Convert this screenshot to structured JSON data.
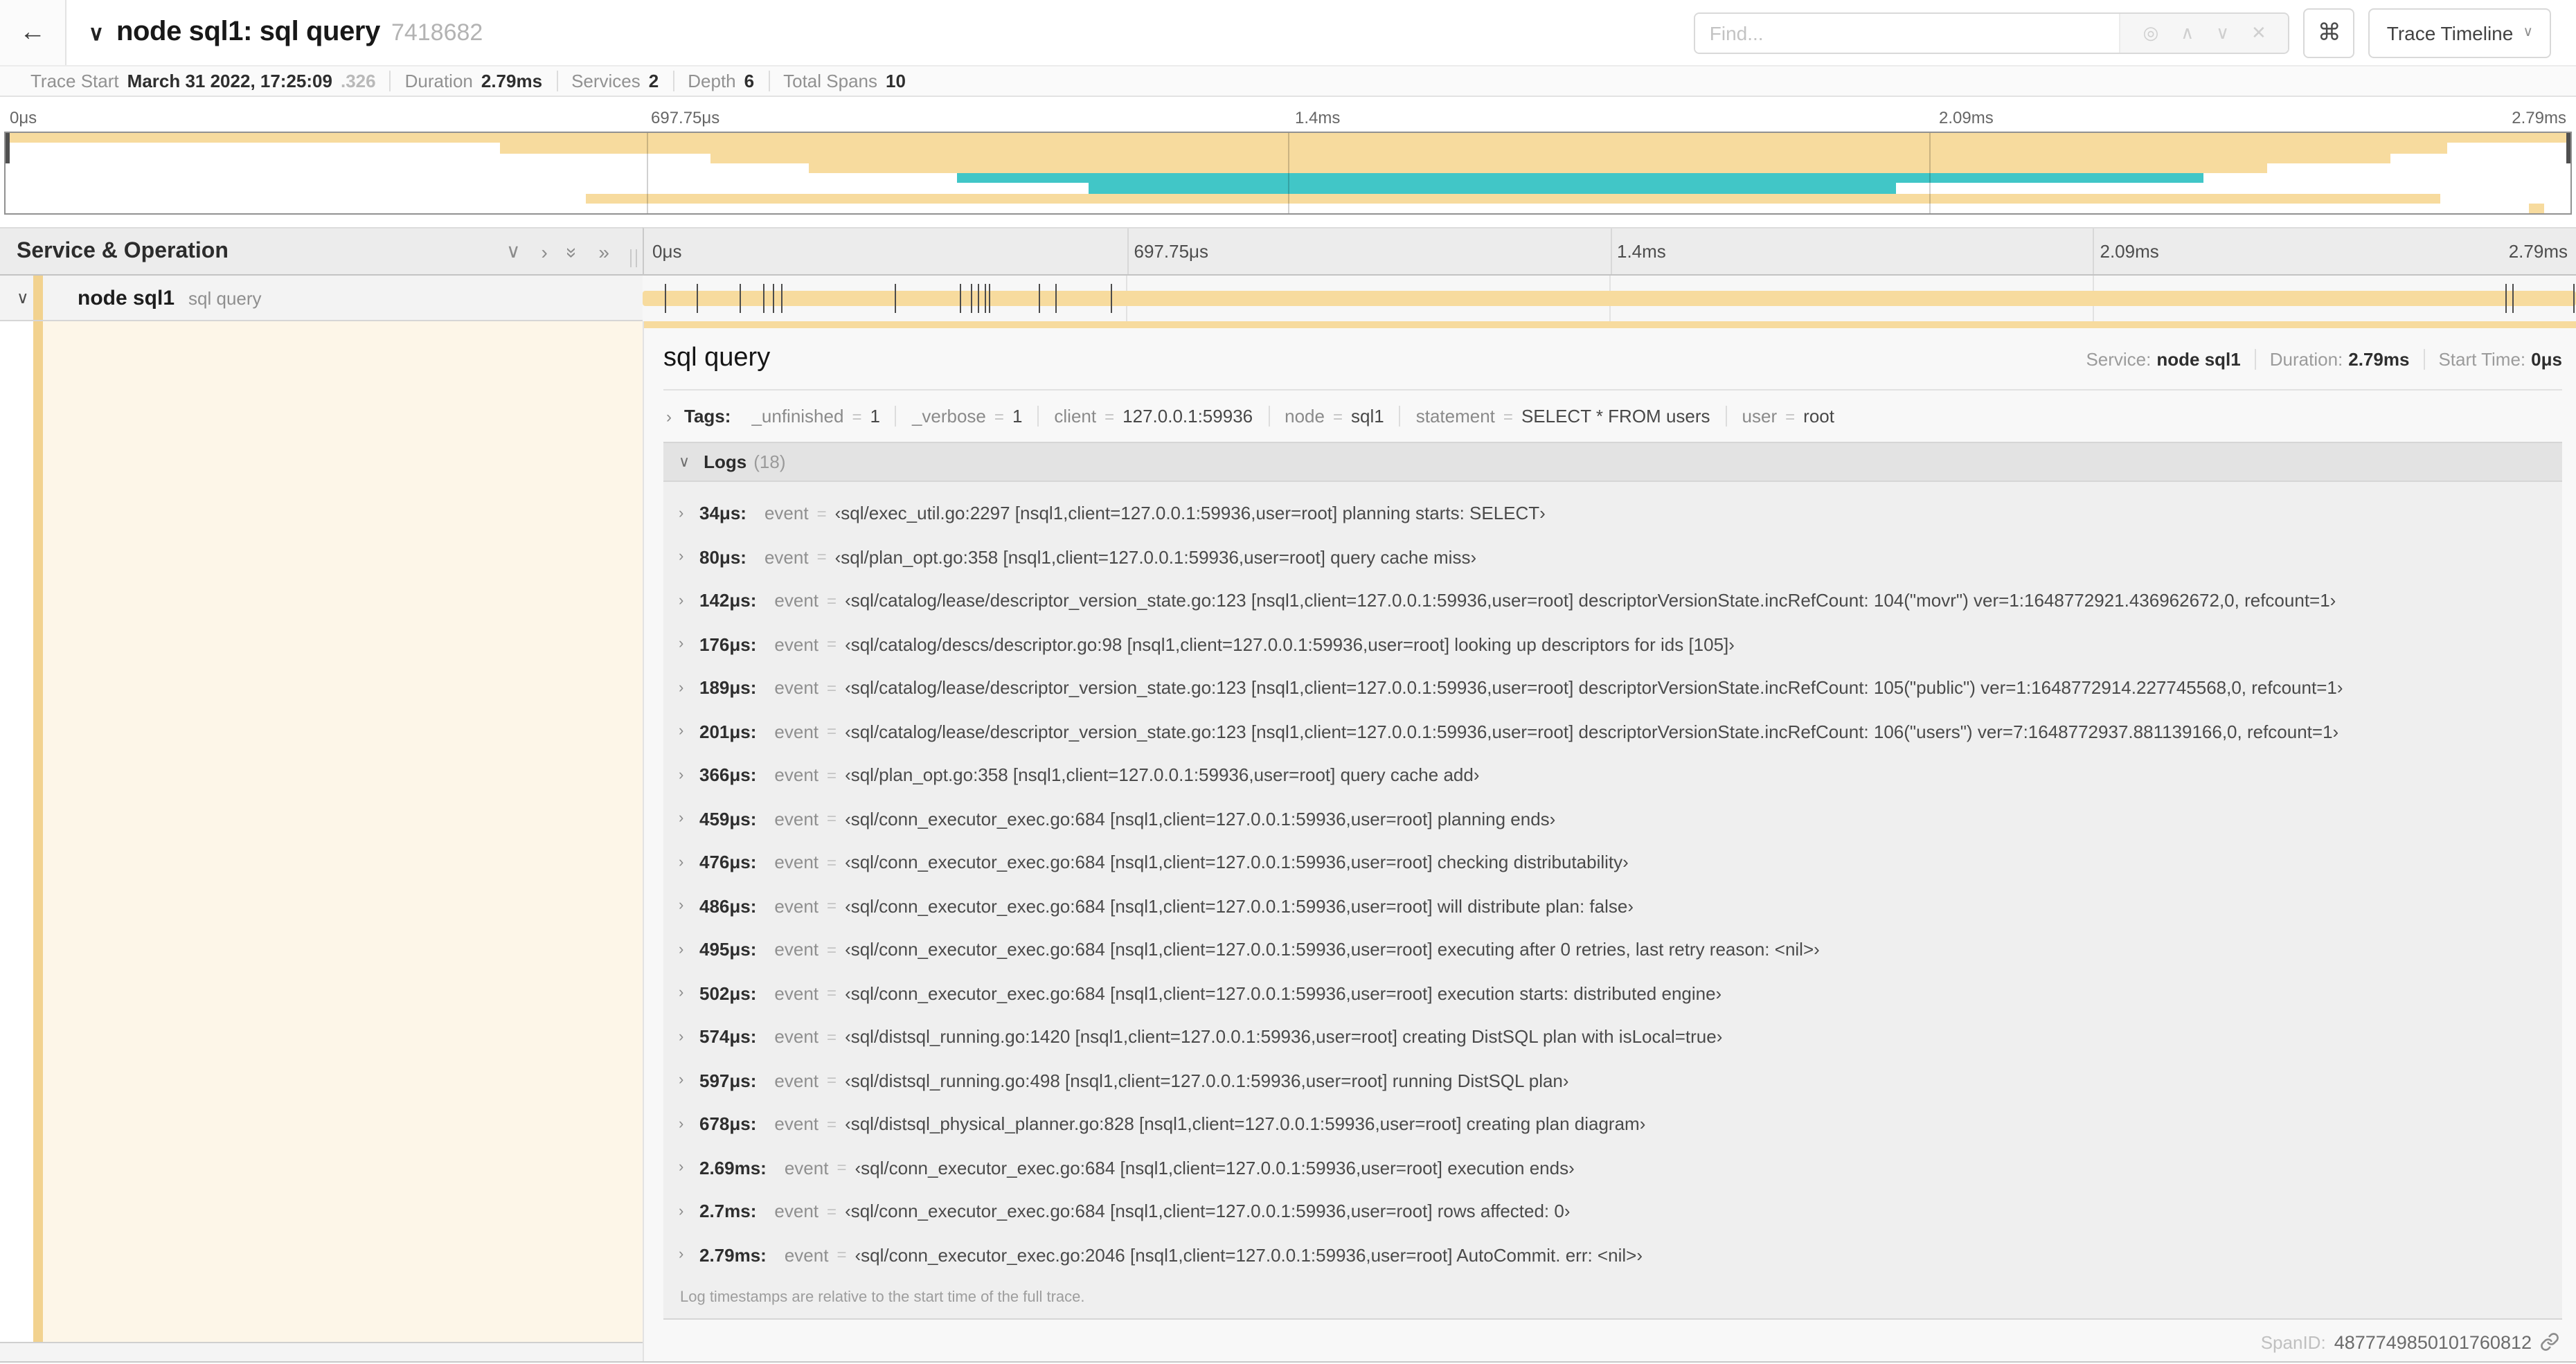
{
  "header": {
    "title": "node sql1: sql query",
    "trace_id_short": "7418682",
    "find_placeholder": "Find...",
    "view_selector": "Trace Timeline"
  },
  "icons": {
    "back": "←",
    "chevron_down": "∨",
    "chevron_up": "∧",
    "chevron_right": "›",
    "double_chevron_right": "»",
    "locate": "◎",
    "close": "✕",
    "command": "⌘"
  },
  "summary": {
    "items": [
      {
        "label": "Trace Start",
        "value": "March 31 2022, 17:25:09",
        "value_suffix": ".326"
      },
      {
        "label": "Duration",
        "value": "2.79ms"
      },
      {
        "label": "Services",
        "value": "2"
      },
      {
        "label": "Depth",
        "value": "6"
      },
      {
        "label": "Total Spans",
        "value": "10"
      }
    ]
  },
  "minimap": {
    "ticks": [
      "0μs",
      "697.75μs",
      "1.4ms",
      "2.09ms",
      "2.79ms"
    ],
    "rows": [
      {
        "color": "tan",
        "start": 0.0,
        "end": 1.0
      },
      {
        "color": "tan",
        "start": 0.193,
        "end": 0.952
      },
      {
        "color": "tan",
        "start": 0.275,
        "end": 0.93
      },
      {
        "color": "tan",
        "start": 0.313,
        "end": 0.882
      },
      {
        "color": "teal",
        "start": 0.371,
        "end": 0.857
      },
      {
        "color": "teal",
        "start": 0.422,
        "end": 0.737
      },
      {
        "color": "tan",
        "start": 0.226,
        "end": 0.949
      },
      {
        "color": "tan",
        "start": 0.984,
        "end": 0.99
      }
    ]
  },
  "timeline": {
    "left_header": "Service & Operation",
    "ticks": [
      "0μs",
      "697.75μs",
      "1.4ms",
      "2.09ms",
      "2.79ms"
    ],
    "span": {
      "service": "node sql1",
      "operation": "sql query",
      "start_frac": 0,
      "end_frac": 1,
      "log_marks": [
        0.0122,
        0.0287,
        0.0509,
        0.0631,
        0.0677,
        0.072,
        0.1312,
        0.1645,
        0.1706,
        0.1742,
        0.1774,
        0.1799,
        0.2057,
        0.214,
        0.243,
        0.9642,
        0.9677,
        0.9995
      ]
    }
  },
  "detail": {
    "operation": "sql query",
    "service_label": "Service:",
    "service": "node sql1",
    "duration_label": "Duration:",
    "duration": "2.79ms",
    "start_label": "Start Time:",
    "start": "0μs",
    "tags_label": "Tags:",
    "tags": [
      {
        "key": "_unfinished",
        "value": "1"
      },
      {
        "key": "_verbose",
        "value": "1"
      },
      {
        "key": "client",
        "value": "127.0.0.1:59936"
      },
      {
        "key": "node",
        "value": "sql1"
      },
      {
        "key": "statement",
        "value": "SELECT * FROM users"
      },
      {
        "key": "user",
        "value": "root"
      }
    ],
    "logs_label": "Logs",
    "logs_count": "(18)",
    "logs_key": "event",
    "logs": [
      {
        "t": "34μs:",
        "v": "‹sql/exec_util.go:2297 [nsql1,client=127.0.0.1:59936,user=root] planning starts: SELECT›"
      },
      {
        "t": "80μs:",
        "v": "‹sql/plan_opt.go:358 [nsql1,client=127.0.0.1:59936,user=root] query cache miss›"
      },
      {
        "t": "142μs:",
        "v": "‹sql/catalog/lease/descriptor_version_state.go:123 [nsql1,client=127.0.0.1:59936,user=root] descriptorVersionState.incRefCount: 104(\"movr\") ver=1:1648772921.436962672,0, refcount=1›"
      },
      {
        "t": "176μs:",
        "v": "‹sql/catalog/descs/descriptor.go:98 [nsql1,client=127.0.0.1:59936,user=root] looking up descriptors for ids [105]›"
      },
      {
        "t": "189μs:",
        "v": "‹sql/catalog/lease/descriptor_version_state.go:123 [nsql1,client=127.0.0.1:59936,user=root] descriptorVersionState.incRefCount: 105(\"public\") ver=1:1648772914.227745568,0, refcount=1›"
      },
      {
        "t": "201μs:",
        "v": "‹sql/catalog/lease/descriptor_version_state.go:123 [nsql1,client=127.0.0.1:59936,user=root] descriptorVersionState.incRefCount: 106(\"users\") ver=7:1648772937.881139166,0, refcount=1›"
      },
      {
        "t": "366μs:",
        "v": "‹sql/plan_opt.go:358 [nsql1,client=127.0.0.1:59936,user=root] query cache add›"
      },
      {
        "t": "459μs:",
        "v": "‹sql/conn_executor_exec.go:684 [nsql1,client=127.0.0.1:59936,user=root] planning ends›"
      },
      {
        "t": "476μs:",
        "v": "‹sql/conn_executor_exec.go:684 [nsql1,client=127.0.0.1:59936,user=root] checking distributability›"
      },
      {
        "t": "486μs:",
        "v": "‹sql/conn_executor_exec.go:684 [nsql1,client=127.0.0.1:59936,user=root] will distribute plan: false›"
      },
      {
        "t": "495μs:",
        "v": "‹sql/conn_executor_exec.go:684 [nsql1,client=127.0.0.1:59936,user=root] executing after 0 retries, last retry reason: <nil>›"
      },
      {
        "t": "502μs:",
        "v": "‹sql/conn_executor_exec.go:684 [nsql1,client=127.0.0.1:59936,user=root] execution starts: distributed engine›"
      },
      {
        "t": "574μs:",
        "v": "‹sql/distsql_running.go:1420 [nsql1,client=127.0.0.1:59936,user=root] creating DistSQL plan with isLocal=true›"
      },
      {
        "t": "597μs:",
        "v": "‹sql/distsql_running.go:498 [nsql1,client=127.0.0.1:59936,user=root] running DistSQL plan›"
      },
      {
        "t": "678μs:",
        "v": "‹sql/distsql_physical_planner.go:828 [nsql1,client=127.0.0.1:59936,user=root] creating plan diagram›"
      },
      {
        "t": "2.69ms:",
        "v": "‹sql/conn_executor_exec.go:684 [nsql1,client=127.0.0.1:59936,user=root] execution ends›"
      },
      {
        "t": "2.7ms:",
        "v": "‹sql/conn_executor_exec.go:684 [nsql1,client=127.0.0.1:59936,user=root] rows affected: 0›"
      },
      {
        "t": "2.79ms:",
        "v": "‹sql/conn_executor_exec.go:2046 [nsql1,client=127.0.0.1:59936,user=root] AutoCommit. err: <nil>›"
      }
    ],
    "footer_note": "Log timestamps are relative to the start time of the full trace.",
    "span_id_label": "SpanID:",
    "span_id": "4877749850101760812"
  },
  "colors": {
    "span_tan": "#F7DB9E",
    "span_tan_strip": "#F2D28F",
    "span_teal": "#41C6C7",
    "detail_cream": "#FDF6E8"
  }
}
